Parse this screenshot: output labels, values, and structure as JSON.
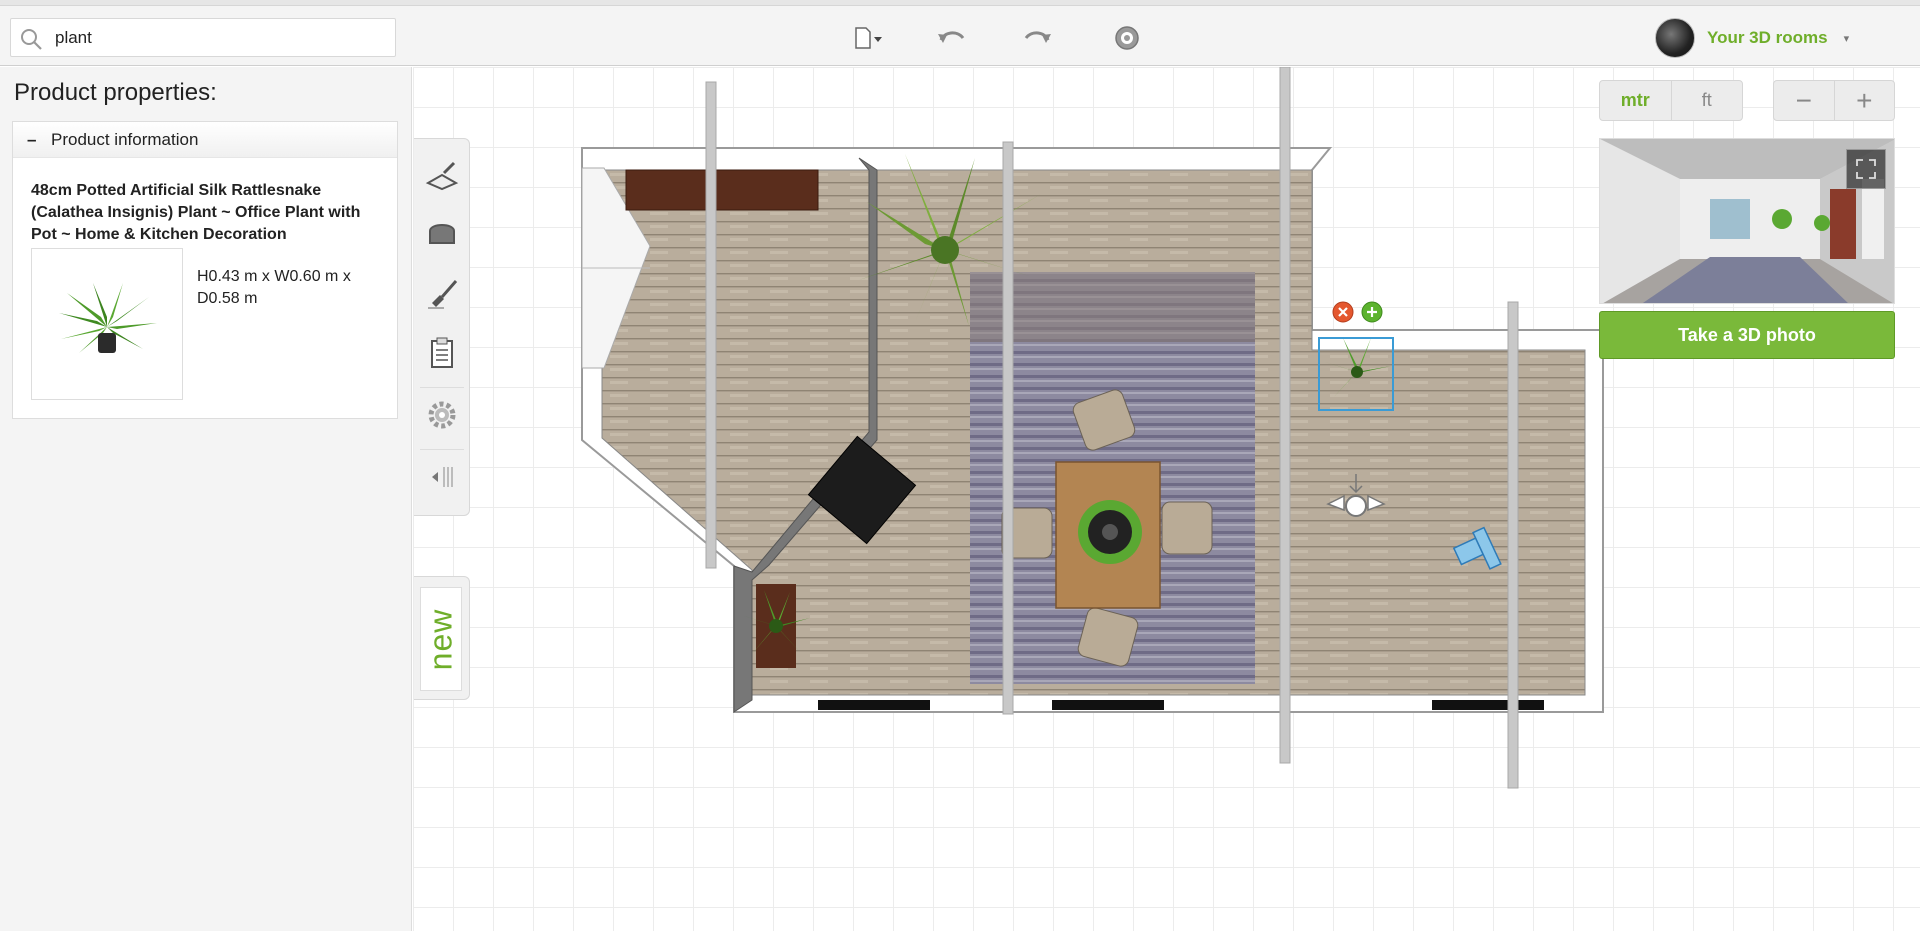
{
  "search": {
    "value": "plant",
    "placeholder": ""
  },
  "toolbar": {
    "items": [
      {
        "icon": "new-document-icon"
      },
      {
        "icon": "undo-icon"
      },
      {
        "icon": "redo-icon"
      },
      {
        "icon": "help-icon"
      }
    ]
  },
  "user": {
    "label": "Your 3D rooms",
    "icon": "user-avatar",
    "caret": "▾"
  },
  "panel": {
    "title": "Product properties:",
    "section": {
      "toggle": "–",
      "title": "Product information"
    },
    "product": {
      "name": "48cm Potted Artificial Silk Rattlesnake (Calathea Insignis) Plant ~ Office Plant with Pot ~ Home & Kitchen Decoration",
      "dimensions": "H0.43 m x W0.60 m x D0.58 m",
      "image_icon": "plant-thumbnail"
    }
  },
  "side_tools": [
    {
      "icon": "wall-trowel-icon"
    },
    {
      "icon": "armchair-icon"
    },
    {
      "icon": "paint-brush-icon"
    },
    {
      "icon": "clipboard-icon"
    },
    {
      "icon": "settings-gear-icon"
    },
    {
      "icon": "collapse-panel-icon"
    }
  ],
  "new_tab": {
    "label": "new"
  },
  "units": {
    "metric": "mtr",
    "imperial": "ft",
    "selected": "mtr"
  },
  "zoom": {
    "out": "−",
    "in": "+"
  },
  "photo_button": {
    "label": "Take a 3D photo"
  },
  "selection_controls": {
    "delete_icon": "delete-icon",
    "add_icon": "add-icon"
  },
  "colors": {
    "accent": "#6fae2a",
    "button": "#7ab93a",
    "delete": "#e4572e",
    "add": "#5cb32e",
    "selection": "#3a9bd5"
  }
}
